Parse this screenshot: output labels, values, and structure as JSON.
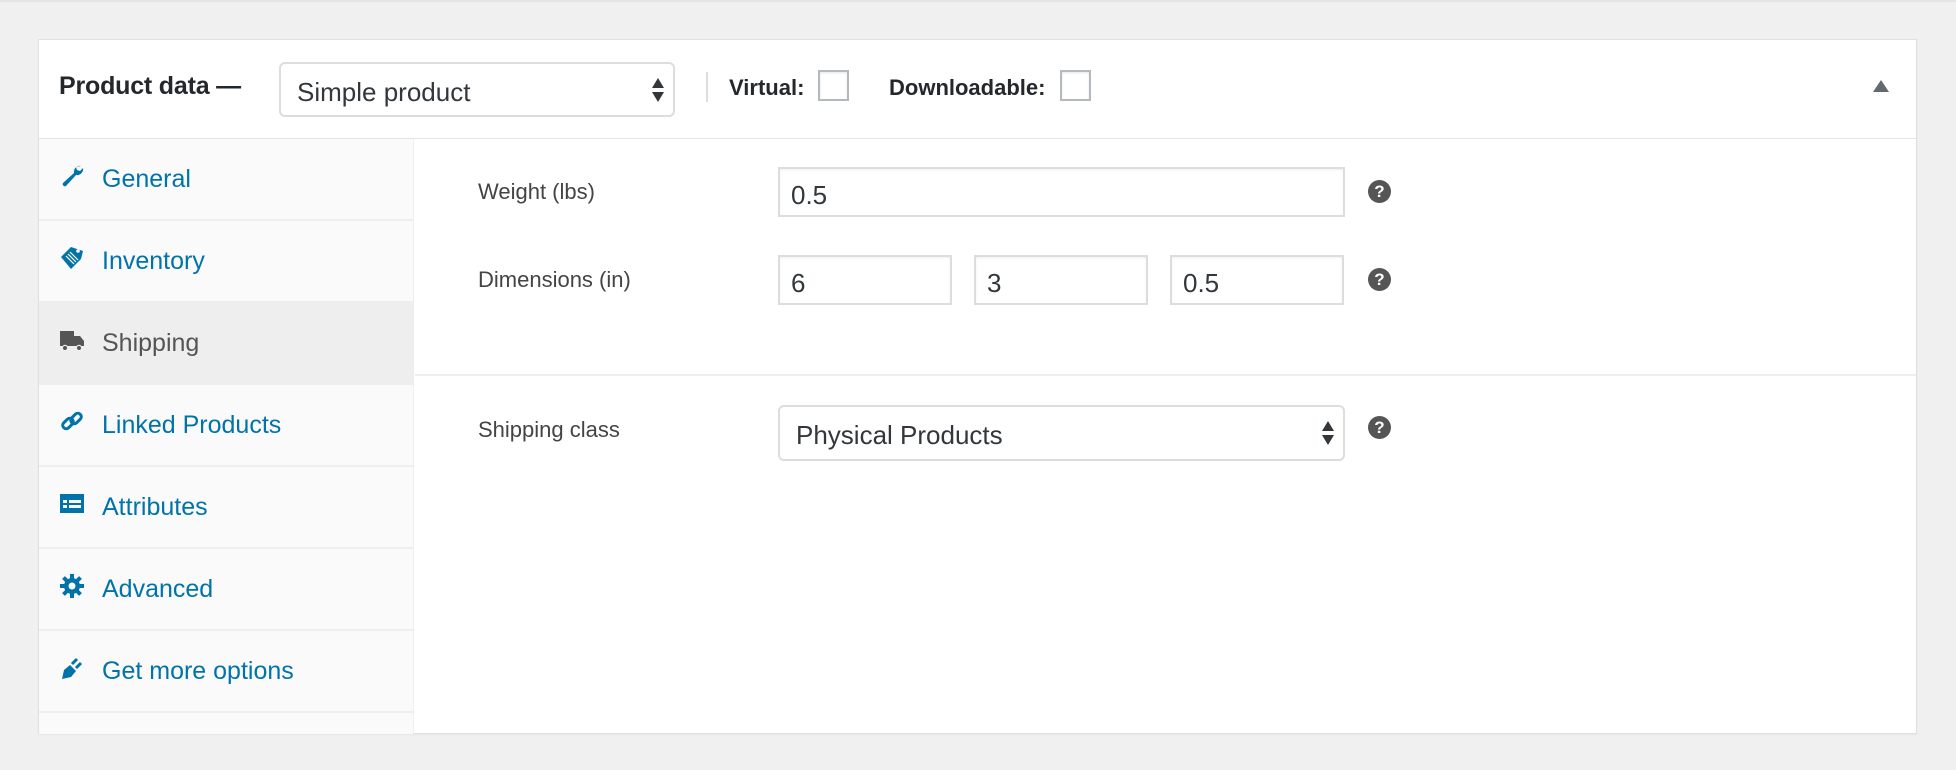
{
  "header": {
    "title": "Product data —",
    "product_type": "Simple product",
    "virtual_label": "Virtual:",
    "virtual_checked": false,
    "downloadable_label": "Downloadable:",
    "downloadable_checked": false,
    "collapse_icon": "triangle-up-icon"
  },
  "sidebar": {
    "active": "Shipping",
    "items": [
      {
        "label": "General",
        "icon": "wrench-icon"
      },
      {
        "label": "Inventory",
        "icon": "tag-icon"
      },
      {
        "label": "Shipping",
        "icon": "truck-icon"
      },
      {
        "label": "Linked Products",
        "icon": "link-icon"
      },
      {
        "label": "Attributes",
        "icon": "list-card-icon"
      },
      {
        "label": "Advanced",
        "icon": "gear-icon"
      },
      {
        "label": "Get more options",
        "icon": "plugin-icon"
      }
    ]
  },
  "shipping": {
    "weight_label": "Weight (lbs)",
    "weight_value": "0.5",
    "dimensions_label": "Dimensions (in)",
    "length_value": "6",
    "width_value": "3",
    "height_value": "0.5",
    "shipping_class_label": "Shipping class",
    "shipping_class_value": "Physical Products",
    "help_glyph": "?"
  },
  "colors": {
    "link": "#0073aa",
    "active_tab_bg": "#eeeeee",
    "active_tab_text": "#555555",
    "help_icon": "#555555"
  }
}
